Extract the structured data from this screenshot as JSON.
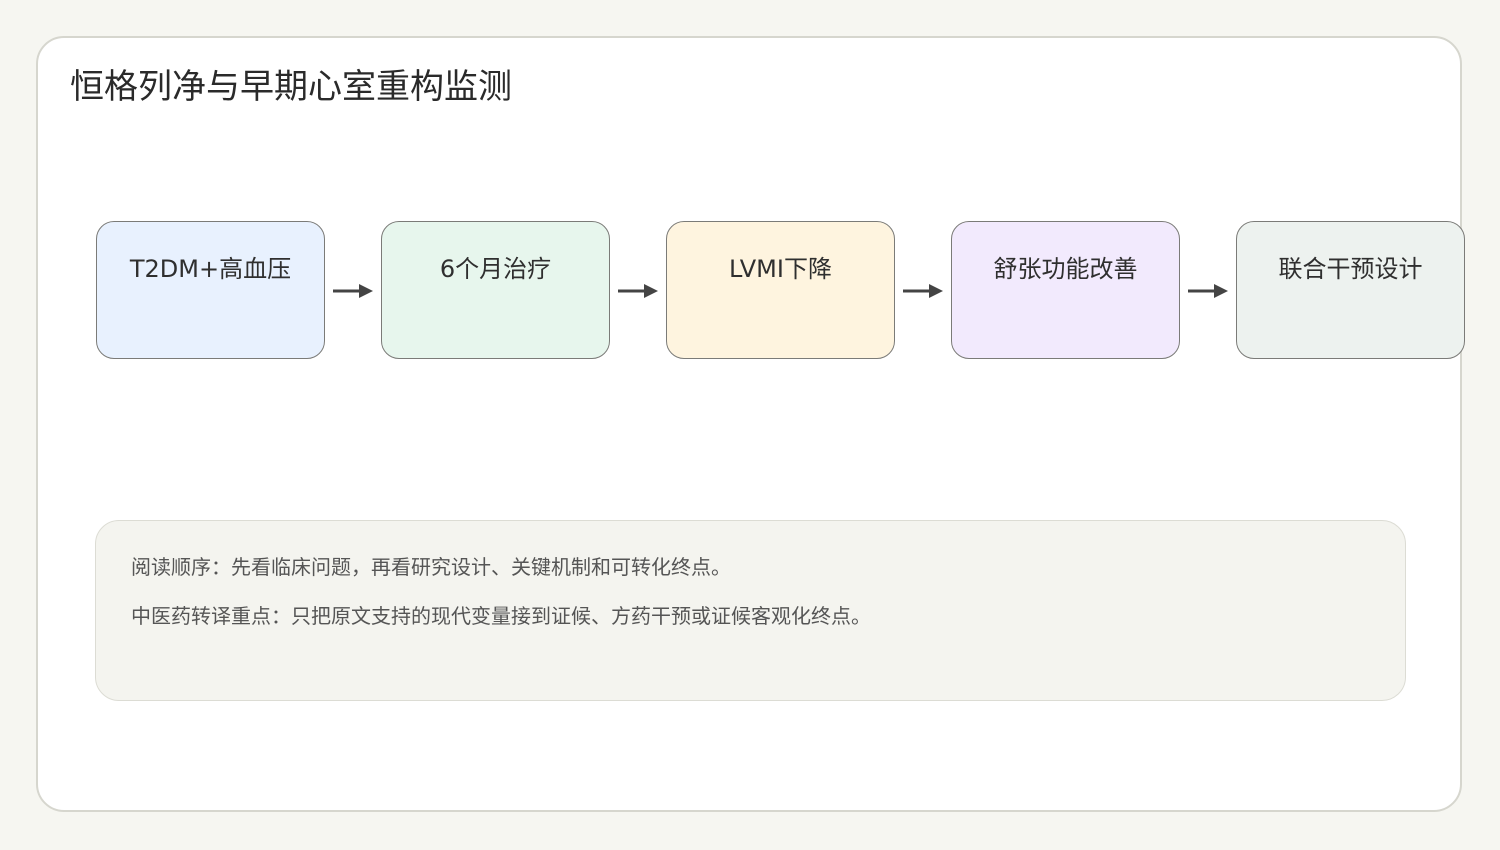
{
  "title": "恒格列净与早期心室重构监测",
  "flow": {
    "nodes": [
      {
        "label": "T2DM+高血压",
        "fill": "#e8f1fe"
      },
      {
        "label": "6个月治疗",
        "fill": "#e7f6ed"
      },
      {
        "label": "LVMI下降",
        "fill": "#fef4df"
      },
      {
        "label": "舒张功能改善",
        "fill": "#f2eafd"
      },
      {
        "label": "联合干预设计",
        "fill": "#edf2ef"
      }
    ],
    "arrow_color": "#444444"
  },
  "note": {
    "line1": "阅读顺序：先看临床问题，再看研究设计、关键机制和可转化终点。",
    "line2": "中医药转译重点：只把原文支持的现代变量接到证候、方药干预或证候客观化终点。"
  }
}
